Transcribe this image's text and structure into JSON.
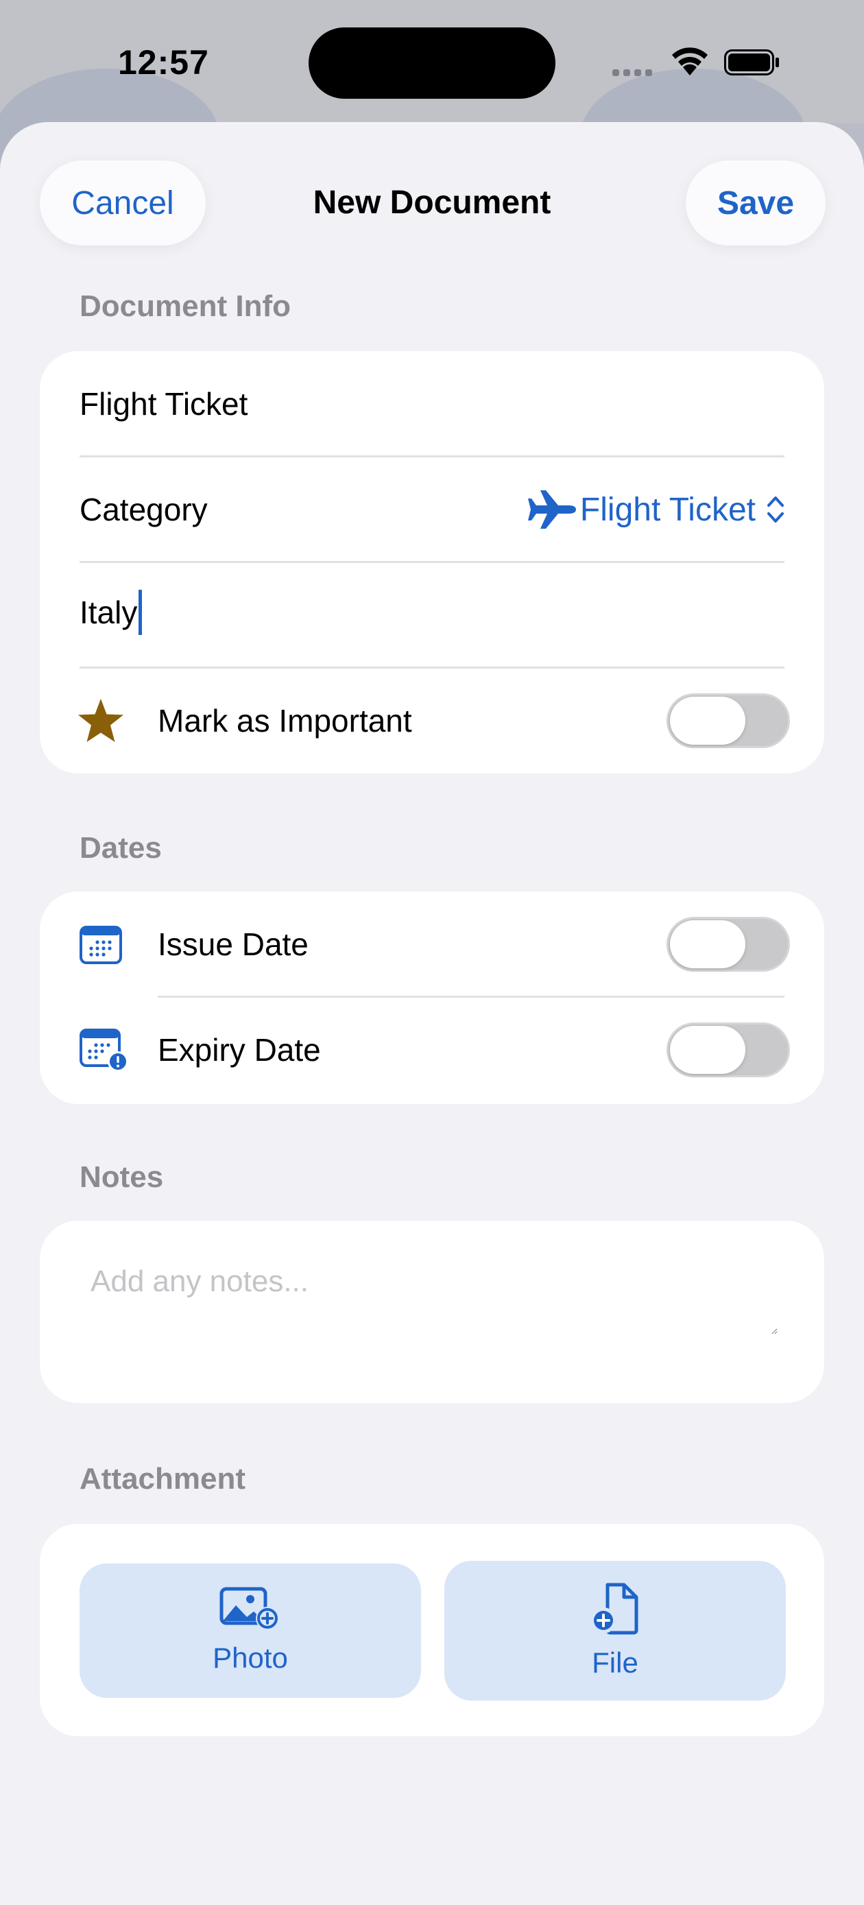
{
  "status_bar": {
    "time": "12:57"
  },
  "nav": {
    "cancel_label": "Cancel",
    "title": "New Document",
    "save_label": "Save"
  },
  "document_info": {
    "header": "Document Info",
    "name_value": "Flight Ticket",
    "category_label": "Category",
    "category_value": "Flight Ticket",
    "location_value": "Italy",
    "important_label": "Mark as Important",
    "important_on": false
  },
  "dates": {
    "header": "Dates",
    "issue_label": "Issue Date",
    "issue_on": false,
    "expiry_label": "Expiry Date",
    "expiry_on": false
  },
  "notes": {
    "header": "Notes",
    "placeholder": "Add any notes..."
  },
  "attachment": {
    "header": "Attachment",
    "photo_label": "Photo",
    "file_label": "File"
  },
  "colors": {
    "accent": "#1f64c8",
    "star": "#8a5f0a",
    "background": "#f1f1f6",
    "button_tint": "#d9e6f8"
  }
}
